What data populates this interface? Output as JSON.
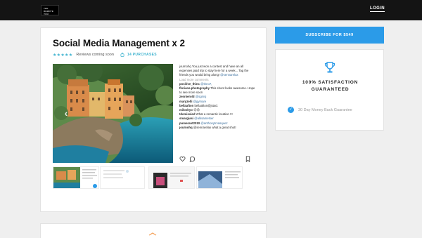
{
  "nav": {
    "logo_line1": "THE",
    "logo_line2": "REMOTE",
    "logo_line3": "YOU",
    "login_label": "LOGIN"
  },
  "product": {
    "title": "Social Media Management x 2",
    "stars": "★★★★★",
    "rating": 5,
    "reviews_text": "Reviews coming soon",
    "purchases": "14 PURCHASES",
    "comments": [
      {
        "user": "",
        "text": "journohq You just won a contest and have an all expenses paid trip to stay here for a week... Tag the friends you would bring along! ",
        "mention": "@sennarelax"
      },
      {
        "user": "",
        "text": "Load more comments",
        "muted": true
      },
      {
        "user": "positive_thinc",
        "text": "@theo7,",
        "link": true
      },
      {
        "user": "florians.photography",
        "text": "This shoot looks awesome. Hope to see more soon"
      },
      {
        "user": "zennierold",
        "text": "@sgmsj",
        "link": true
      },
      {
        "user": "maryzelli",
        "text": "@gymare",
        "link": true
      },
      {
        "user": "bellaafton",
        "text": "bellaafton@jsiacl.",
        "link": true
      },
      {
        "user": "miloshyo",
        "text": "😍😍"
      },
      {
        "user": "tdemissied",
        "text": "What a romantic location !!!"
      },
      {
        "user": "smargiasi",
        "text": "@alksametser",
        "link": true
      },
      {
        "user": "pumerant2010",
        "text": "@anthonytrvasquez",
        "link": true
      },
      {
        "user": "journohq",
        "text": "@sennarelax what a great shot!",
        "mention_first": true
      }
    ]
  },
  "sidebar": {
    "subscribe_label": "SUBSCRIBE FOR $549",
    "satisfaction_line1": "100% SATISFACTION",
    "satisfaction_line2": "GUARANTEED",
    "guarantee_text": "30 Day Money Back Guarantee"
  },
  "colors": {
    "accent": "#2b9be8",
    "star": "#3fb3cf",
    "topbar": "#141414",
    "background": "#efefef",
    "trophy": "#2b9be8",
    "lower_icon": "#f4a25a"
  },
  "icons": {
    "prev": "chevron-left-icon",
    "next": "chevron-right-icon",
    "like": "heart-icon",
    "comment": "comment-icon",
    "save": "bookmark-icon",
    "purchases": "shopping-bag-icon",
    "trophy": "trophy-icon",
    "guarantee": "check-circle-icon"
  }
}
